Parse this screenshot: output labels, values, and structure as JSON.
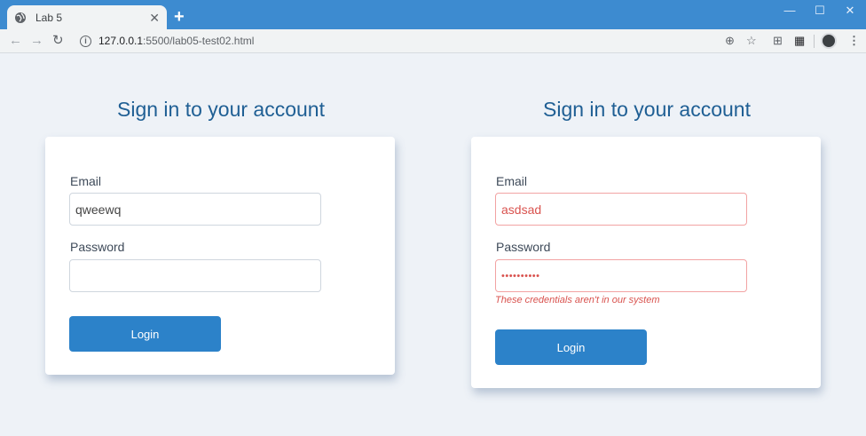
{
  "browser": {
    "tab_title": "Lab 5",
    "tab_close": "✕",
    "new_tab": "+",
    "url_host": "127.0.0.1",
    "url_path": ":5500/lab05-test02.html",
    "window_controls": {
      "minimize": "—",
      "maximize": "☐",
      "close": "✕"
    }
  },
  "forms": [
    {
      "heading": "Sign in to your account",
      "email_label": "Email",
      "email_value": "qweewq",
      "password_label": "Password",
      "password_value": "",
      "login_label": "Login"
    },
    {
      "heading": "Sign in to your account",
      "email_label": "Email",
      "email_value": "asdsad",
      "password_label": "Password",
      "password_value": "••••••••••",
      "error_message": "These credentials aren't in our system",
      "login_label": "Login"
    }
  ],
  "colors": {
    "heading": "#1f5f94",
    "button": "#2c82c9",
    "error": "#d9534f",
    "titlebar": "#3d8bd0"
  }
}
